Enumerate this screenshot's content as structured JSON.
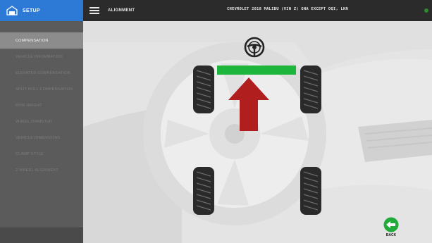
{
  "sidebar": {
    "header_label": "SETUP",
    "items": [
      {
        "label": "COMPENSATION",
        "active": true
      },
      {
        "label": "VEHICLE INFORMATION",
        "active": false
      },
      {
        "label": "ELEVATED COMPENSATION",
        "active": false
      },
      {
        "label": "SPLIT ROLL COMPENSATION",
        "active": false
      },
      {
        "label": "RIDE HEIGHT",
        "active": false
      },
      {
        "label": "WHEEL DIAMETER",
        "active": false
      },
      {
        "label": "VEHICLE DIMENSIONS",
        "active": false
      },
      {
        "label": "CLAMP STYLE",
        "active": false
      },
      {
        "label": "2-WHEEL ALIGNMENT",
        "active": false
      }
    ]
  },
  "topbar": {
    "title": "ALIGNMENT",
    "vehicle": "CHEVROLET 2018 MALIBU (VIN Z) GNA EXCEPT OQI, LKN"
  },
  "main": {
    "back_label": "BACK"
  },
  "icons": {
    "setup": "garage-icon",
    "menu": "hamburger-icon",
    "steering": "steering-wheel-icon",
    "arrow": "forward-arrow-icon",
    "back": "back-arrow-icon"
  },
  "colors": {
    "accent": "#2c7ad6",
    "axle_bar": "#1db53b",
    "arrow": "#b01e1e",
    "back_button": "#1faa3a"
  }
}
